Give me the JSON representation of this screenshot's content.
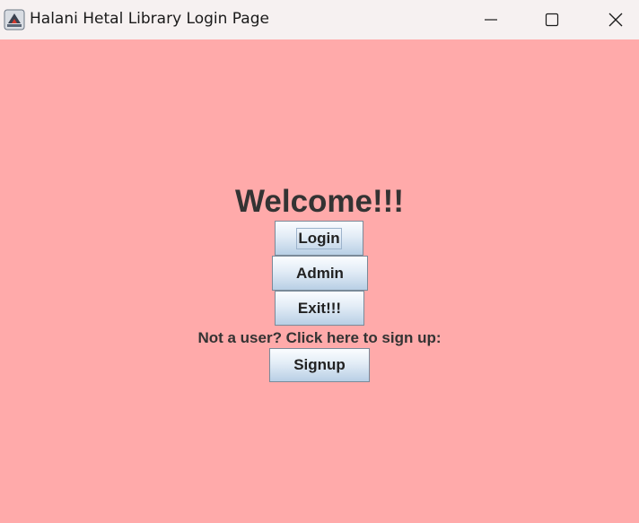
{
  "window": {
    "title": "Halani Hetal Library Login Page",
    "background_color": "#ffaaaa",
    "controls": {
      "minimize_icon": "minimize-icon",
      "maximize_icon": "maximize-icon",
      "close_icon": "close-icon"
    }
  },
  "main": {
    "heading": "Welcome!!!",
    "buttons": {
      "login": "Login",
      "admin": "Admin",
      "exit": "Exit!!!"
    },
    "signup_prompt": "Not a user? Click here to sign up:",
    "signup_button": "Signup"
  }
}
